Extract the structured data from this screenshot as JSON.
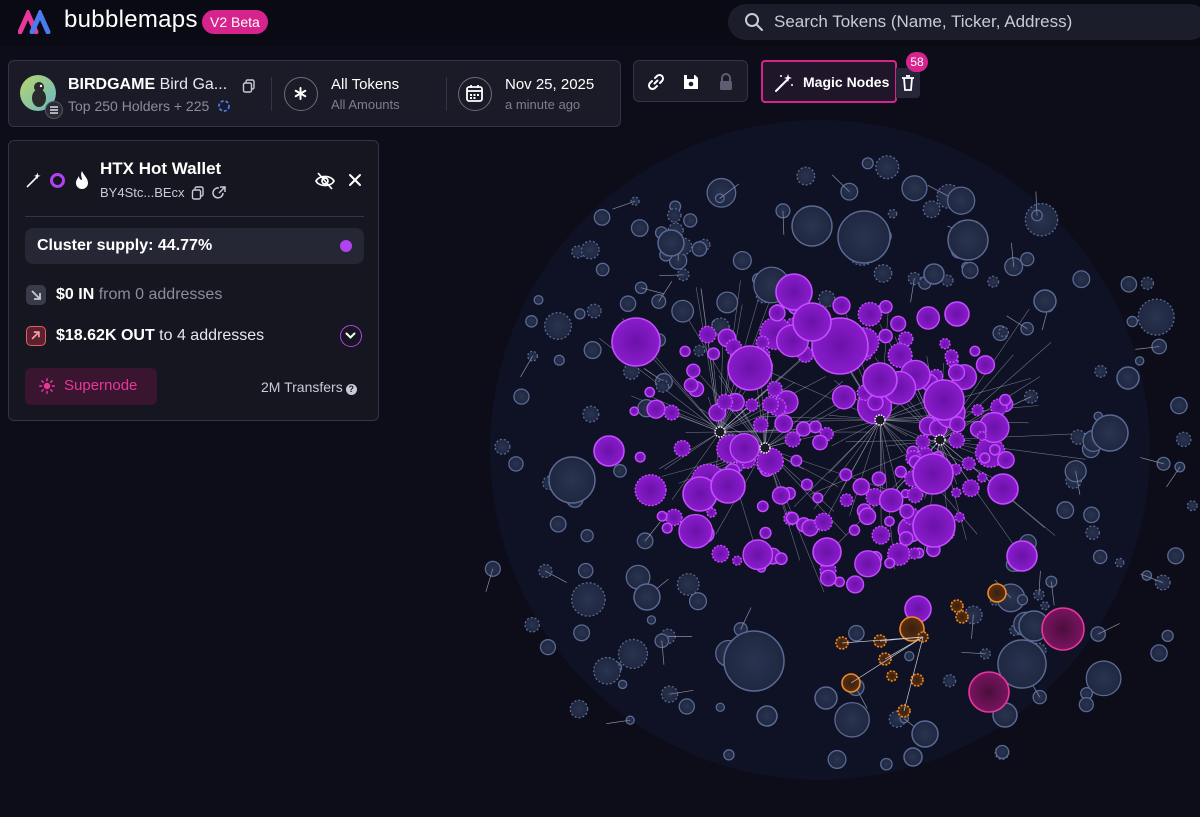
{
  "app": {
    "brand": "bubblemaps",
    "badge": "V2 Beta",
    "search_placeholder": "Search Tokens (Name, Ticker, Address)"
  },
  "token": {
    "symbol": "BIRDGAME",
    "name": "Bird Ga...",
    "holders_text": "Top 250 Holders + 225",
    "filter_title": "All Tokens",
    "filter_sub": "All Amounts",
    "date": "Nov 25, 2025",
    "updated": "a minute ago"
  },
  "toolbar": {
    "magic_label": "Magic Nodes",
    "magic_count": "58",
    "icons": [
      "link-icon",
      "save-icon",
      "lock-icon",
      "magic-wand-icon",
      "trash-icon"
    ]
  },
  "wallet_panel": {
    "title": "HTX Hot Wallet",
    "address": "BY4Stc...BEcx",
    "cluster_label": "Cluster supply: 44.77%",
    "in_amount": "$0 IN",
    "in_from": "from 0 addresses",
    "out_amount": "$18.62K OUT",
    "out_to": "to 4 addresses",
    "supernode_label": "Supernode",
    "transfers": "2M Transfers"
  },
  "colors": {
    "accent": "#d6248c",
    "cluster_purple": "#b042f0",
    "orange_cluster": "#f08a24",
    "neutral_bubble": "#5a6a94"
  }
}
